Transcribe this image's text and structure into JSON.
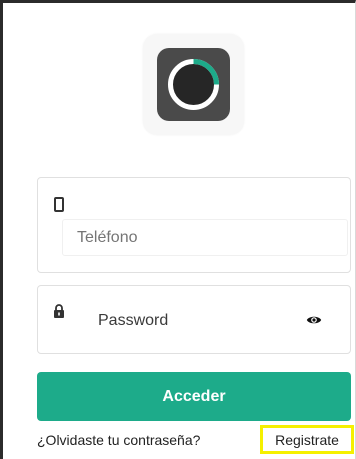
{
  "login": {
    "phone": {
      "placeholder": "Teléfono",
      "value": "",
      "icon": "phone-icon"
    },
    "password": {
      "placeholder": "Password",
      "value": "",
      "icon": "lock-icon",
      "toggle_icon": "eye-icon"
    },
    "submit_label": "Acceder",
    "forgot_label": "¿Olvidaste tu contraseña?",
    "register_label": "Registrate"
  },
  "colors": {
    "accent": "#1dab8a",
    "logo_tile": "#4a4a4a",
    "logo_ring": "#1dab8a",
    "highlight": "#f5f000"
  }
}
